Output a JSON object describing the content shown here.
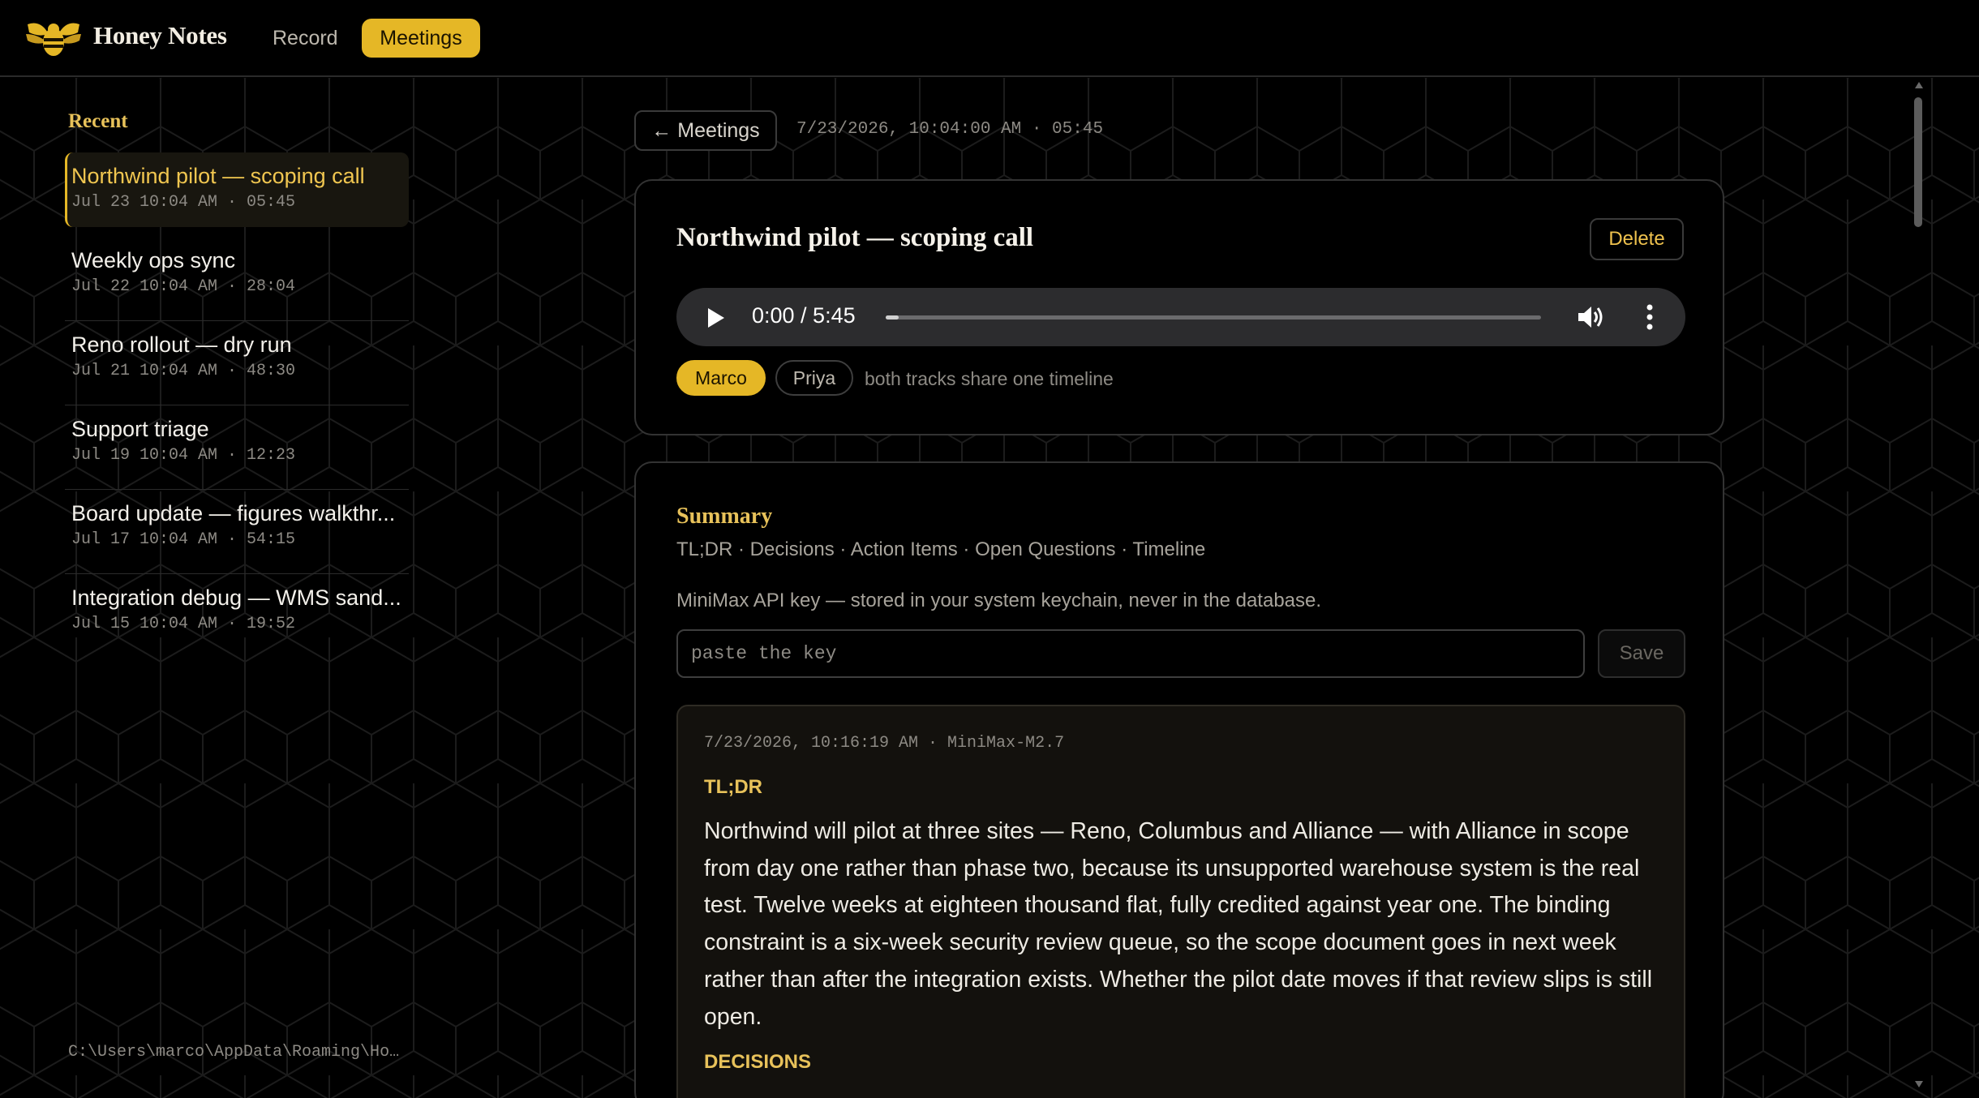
{
  "app": {
    "title": "Honey Notes"
  },
  "nav": {
    "record": "Record",
    "meetings": "Meetings"
  },
  "sidebar": {
    "heading": "Recent",
    "items": [
      {
        "title": "Northwind pilot — scoping call",
        "meta": "Jul 23 10:04 AM · 05:45",
        "active": true
      },
      {
        "title": "Weekly ops sync",
        "meta": "Jul 22 10:04 AM · 28:04"
      },
      {
        "title": "Reno rollout — dry run",
        "meta": "Jul 21 10:04 AM · 48:30"
      },
      {
        "title": "Support triage",
        "meta": "Jul 19 10:04 AM · 12:23"
      },
      {
        "title": "Board update — figures walkthr...",
        "meta": "Jul 17 10:04 AM · 54:15"
      },
      {
        "title": "Integration debug — WMS sand...",
        "meta": "Jul 15 10:04 AM · 19:52"
      }
    ],
    "path": "C:\\Users\\marco\\AppData\\Roaming\\Ho..."
  },
  "meeting": {
    "back_label": "← Meetings",
    "meta": "7/23/2026, 10:04:00 AM · 05:45",
    "title": "Northwind pilot — scoping call",
    "delete_label": "Delete",
    "player": {
      "time": "0:00 / 5:45",
      "progress": 0.02
    },
    "speakers": [
      "Marco",
      "Priya"
    ],
    "tracks_note": "both tracks share one timeline"
  },
  "summary": {
    "heading": "Summary",
    "sections_line": "TL;DR · Decisions · Action Items · Open Questions · Timeline",
    "api_label": "MiniMax API key — stored in your system keychain, never in the database.",
    "key_placeholder": "paste the key",
    "save_label": "Save",
    "generated_meta": "7/23/2026, 10:16:19 AM · MiniMax-M2.7",
    "tldr_heading": "TL;DR",
    "tldr_text": "Northwind will pilot at three sites — Reno, Columbus and Alliance — with Alliance in scope from day one rather than phase two, because its unsupported warehouse system is the real test. Twelve weeks at eighteen thousand flat, fully credited against year one. The binding constraint is a six-week security review queue, so the scope document goes in next week rather than after the integration exists. Whether the pilot date moves if that review slips is still open.",
    "decisions_heading": "DECISIONS"
  },
  "colors": {
    "accent": "#e5b726",
    "accent_text": "#e8c25a",
    "background": "#000000"
  },
  "icons": [
    "bee-logo-icon",
    "play-icon",
    "volume-icon",
    "more-vertical-icon",
    "scroll-up-icon",
    "scroll-down-icon"
  ]
}
